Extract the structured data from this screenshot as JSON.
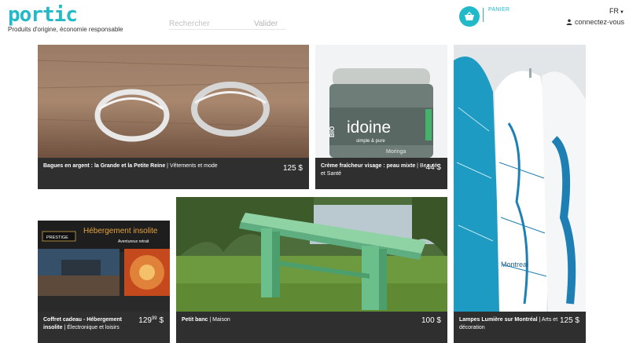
{
  "header": {
    "logo": "portic",
    "tagline": "Produits d'origine, économie responsable",
    "search_placeholder": "Rechercher",
    "search_button": "Valider",
    "cart_label": "PANIER",
    "language": "FR",
    "connect_label": "connectez-vous",
    "accent_color": "#22b9c9"
  },
  "products": [
    {
      "title": "Bagues en argent : la Grande et la Petite Reine",
      "category": "Vêtements et mode",
      "price": "125 $"
    },
    {
      "title": "Crème fraîcheur visage : peau mixte",
      "category": "Beauté et Santé",
      "price": "44 $",
      "image_text": {
        "brand": "idoine",
        "sub": "simple & pure",
        "bio": "BIO",
        "moringa": "Moringa"
      }
    },
    {
      "title": "Lampes Lumière sur Montréal",
      "category": "Arts et décoration",
      "price": "125 $",
      "image_text": {
        "map": "Montreal"
      }
    },
    {
      "title": "Coffret cadeau - Hébergement insolite",
      "category": "Électronique et loisirs",
      "price_main": "129",
      "price_cents": "99",
      "price_currency": "$",
      "image_text": {
        "headline": "Hébergement insolite",
        "sub": "Aventureux retrait",
        "badge": "PRESTIGE"
      }
    },
    {
      "title": "Petit banc",
      "category": "Maison",
      "price": "100 $"
    }
  ]
}
